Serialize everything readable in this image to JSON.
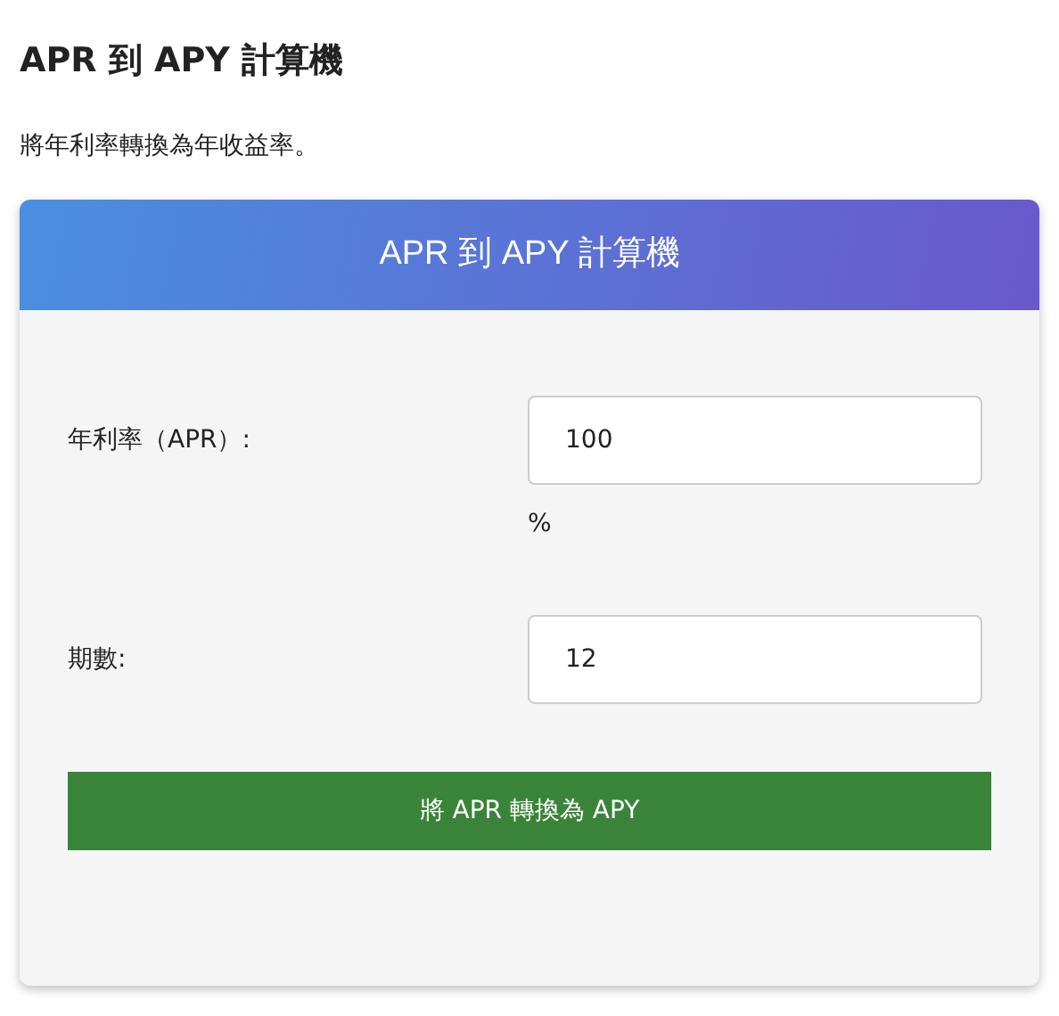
{
  "page": {
    "title": "APR 到 APY 計算機",
    "description": "將年利率轉換為年收益率。"
  },
  "card": {
    "title": "APR 到 APY 計算機",
    "fields": [
      {
        "label": "年利率（APR）:",
        "value": "100",
        "unit": "%"
      },
      {
        "label": "期數:",
        "value": "12"
      }
    ],
    "button": "將 APR 轉換為 APY"
  }
}
